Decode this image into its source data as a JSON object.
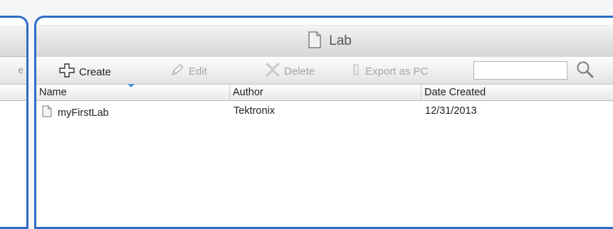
{
  "left_panel": {
    "toolbar_fragment": "e"
  },
  "panel": {
    "title": "Lab",
    "title_icon": "document-icon"
  },
  "toolbar": {
    "create_label": "Create",
    "edit_label": "Edit",
    "delete_label": "Delete",
    "export_label": "Export as PC",
    "search_value": "",
    "search_placeholder": ""
  },
  "grid": {
    "columns": [
      "Name",
      "Author",
      "Date Created"
    ],
    "rows": [
      {
        "name": "myFirstLab",
        "author": "Tektronix",
        "date_created": "12/31/2013"
      }
    ]
  },
  "colors": {
    "accent": "#2d6fc5",
    "sort_indicator": "#4a90d9"
  }
}
